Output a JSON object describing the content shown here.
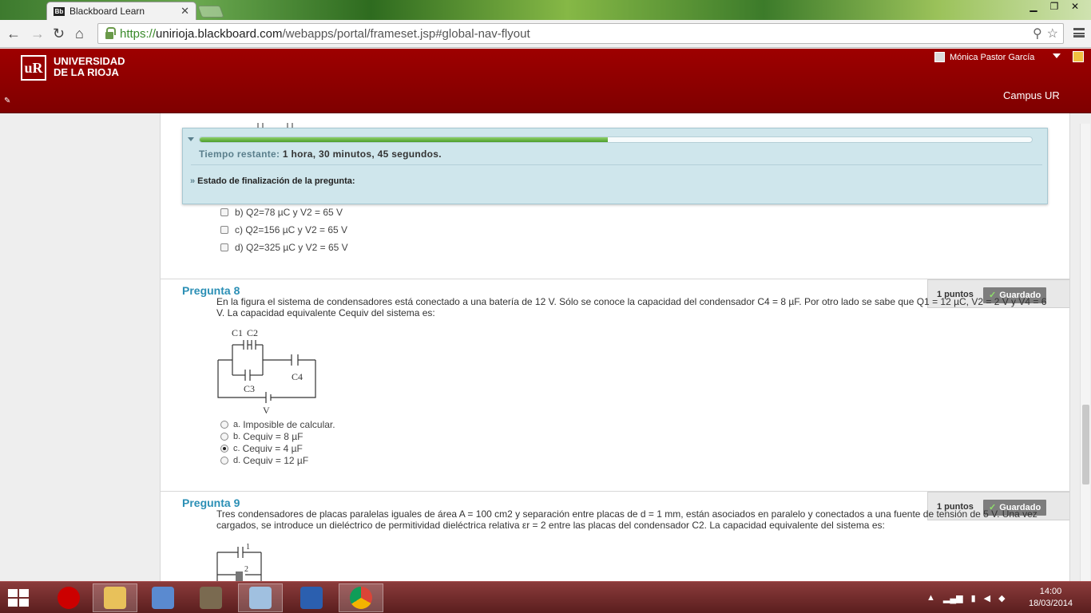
{
  "browser": {
    "tab_title": "Blackboard Learn",
    "tab_favicon": "Bb",
    "url_scheme": "https://",
    "url_host": "unirioja.blackboard.com",
    "url_path": "/webapps/portal/frameset.jsp#global-nav-flyout"
  },
  "header": {
    "logo_mark": "uR",
    "logo_line1": "UNIVERSIDAD",
    "logo_line2": "DE LA RIOJA",
    "user_name": "Mónica Pastor García",
    "campus_link": "Campus UR"
  },
  "timer": {
    "label": "Tiempo restante:",
    "value": "1 hora, 30 minutos, 45 segundos.",
    "progress": 0.49,
    "status_label": "Estado de finalización de la pregunta:"
  },
  "q7": {
    "options": [
      {
        "letter": "b)",
        "text": "Q2=78 µC y V2 = 65 V"
      },
      {
        "letter": "c)",
        "text": "Q2=156 µC y V2 = 65 V"
      },
      {
        "letter": "d)",
        "text": "Q2=325 µC y V2 = 65 V"
      }
    ]
  },
  "q8": {
    "title": "Pregunta 8",
    "points": "1 puntos",
    "saved": "Guardado",
    "text": "En la figura el sistema de condensadores está conectado a una batería de 12 V. Sólo se conoce la capacidad del condensador C4 = 8 µF. Por otro lado se sabe que Q1 = 12 µC, V2 = 2 V y V4 = 6 V. La capacidad equivalente Cequiv del sistema es:",
    "diagram_labels": {
      "c1": "C1",
      "c2": "C2",
      "c3": "C3",
      "c4": "C4",
      "v": "V"
    },
    "answers": [
      {
        "letter": "a.",
        "text": "Imposible de calcular.",
        "selected": false
      },
      {
        "letter": "b.",
        "text": "Cequiv = 8 µF",
        "selected": false
      },
      {
        "letter": "c.",
        "text": "Cequiv = 4 µF",
        "selected": true
      },
      {
        "letter": "d.",
        "text": "Cequiv = 12 µF",
        "selected": false
      }
    ]
  },
  "q9": {
    "title": "Pregunta 9",
    "points": "1 puntos",
    "saved": "Guardado",
    "text": "Tres condensadores de placas paralelas iguales de área A = 100 cm2 y separación entre placas de d = 1 mm, están asociados en paralelo y conectados a una fuente de tensión de 5 V. Una vez cargados, se introduce un dieléctrico de permitividad dieléctrica relativa εr = 2 entre las placas del condensador C2. La capacidad equivalente del sistema es:",
    "diagram_labels": {
      "one": "1",
      "two": "2"
    }
  },
  "taskbar": {
    "time": "14:00",
    "date": "18/03/2014"
  }
}
